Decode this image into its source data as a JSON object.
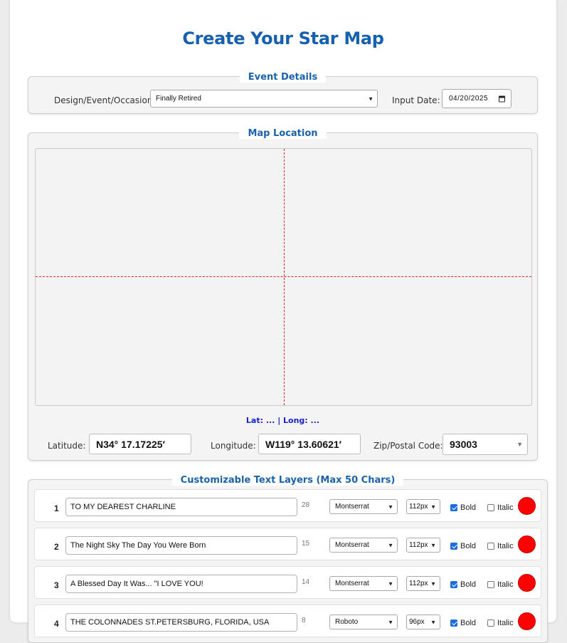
{
  "page": {
    "title": "Create Your Star Map"
  },
  "event_details": {
    "legend": "Event Details",
    "design_label": "Design/Event/Occasion:",
    "design_value": "Finally Retired",
    "date_label": "Input Date:",
    "date_value": "04/20/2025"
  },
  "map_location": {
    "legend": "Map Location",
    "latlong_readout": "Lat: ... | Long: ...",
    "latitude_label": "Latitude:",
    "latitude_value": "N34° 17.17225′",
    "longitude_label": "Longitude:",
    "longitude_value": "W119° 13.60621′",
    "zip_label": "Zip/Postal Code:",
    "zip_value": "93003"
  },
  "text_layers": {
    "legend": "Customizable Text Layers (Max 50 Chars)",
    "accent_color": "#ff0000",
    "rows": [
      {
        "num": "1",
        "text": "TO MY DEAREST CHARLINE",
        "remaining": "28",
        "font": "Montserrat",
        "size": "112px",
        "bold_label": "Bold",
        "bold": true,
        "italic_label": "Italic",
        "italic": false,
        "color": "#ff0000"
      },
      {
        "num": "2",
        "text": "The Night Sky The Day You Were Born",
        "remaining": "15",
        "font": "Montserrat",
        "size": "112px",
        "bold_label": "Bold",
        "bold": true,
        "italic_label": "Italic",
        "italic": false,
        "color": "#ff0000"
      },
      {
        "num": "3",
        "text": "A Blessed Day It Was... \"I LOVE YOU!",
        "remaining": "14",
        "font": "Montserrat",
        "size": "112px",
        "bold_label": "Bold",
        "bold": true,
        "italic_label": "Italic",
        "italic": false,
        "color": "#ff0000"
      },
      {
        "num": "4",
        "text": "THE COLONNADES ST.PETERSBURG, FLORIDA, USA",
        "remaining": "8",
        "font": "Roboto",
        "size": "96px",
        "bold_label": "Bold",
        "bold": true,
        "italic_label": "Italic",
        "italic": false,
        "color": "#ff0000"
      }
    ]
  }
}
